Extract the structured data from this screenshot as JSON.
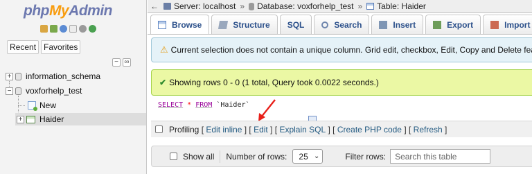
{
  "logo": {
    "php": "php",
    "my": "My",
    "admin": "Admin"
  },
  "quick_icons": [
    "home-icon",
    "exit-icon",
    "help-icon",
    "docs-icon",
    "settings-icon",
    "reload-icon"
  ],
  "nav_tabs": {
    "recent": "Recent",
    "favorites": "Favorites"
  },
  "nav_controls": {
    "collapse": "−",
    "link": "∞"
  },
  "tree": {
    "db1": {
      "expander": "+",
      "label": "information_schema"
    },
    "db2": {
      "expander": "−",
      "label": "voxforhelp_test"
    },
    "new": {
      "label": "New"
    },
    "table": {
      "expander": "+",
      "label": "Haider"
    }
  },
  "breadcrumb": {
    "server": "Server: localhost",
    "database": "Database: voxforhelp_test",
    "table": "Table: Haider",
    "separator": "»"
  },
  "tabs": [
    {
      "label": "Browse",
      "icon": "browse-icon"
    },
    {
      "label": "Structure",
      "icon": "structure-icon"
    },
    {
      "label": "SQL",
      "icon": "sql-icon"
    },
    {
      "label": "Search",
      "icon": "search-icon"
    },
    {
      "label": "Insert",
      "icon": "insert-icon"
    },
    {
      "label": "Export",
      "icon": "export-icon"
    },
    {
      "label": "Import",
      "icon": "import-icon"
    }
  ],
  "warning": {
    "icon": "⚠",
    "text": "Current selection does not contain a unique column. Grid edit, checkbox, Edit, Copy and Delete featur"
  },
  "success": {
    "icon": "✔",
    "text": "Showing rows 0 - 0 (1 total, Query took 0.0022 seconds.)"
  },
  "sql": {
    "select": "SELECT",
    "star": "*",
    "from": "FROM",
    "table": "`Haider`"
  },
  "profiling": {
    "label": "Profiling",
    "links": [
      "Edit inline",
      "Edit",
      "Explain SQL",
      "Create PHP code",
      "Refresh"
    ]
  },
  "controls": {
    "show_all": "Show all",
    "rows_label": "Number of rows:",
    "rows_value": "25",
    "filter_label": "Filter rows:",
    "filter_placeholder": "Search this table"
  },
  "colors": {
    "warning_bg": "#e5f2f8",
    "success_bg": "#ebf8a4",
    "link": "#235a81",
    "tab_text": "#2a4f8a",
    "arrow": "#e8201a"
  }
}
